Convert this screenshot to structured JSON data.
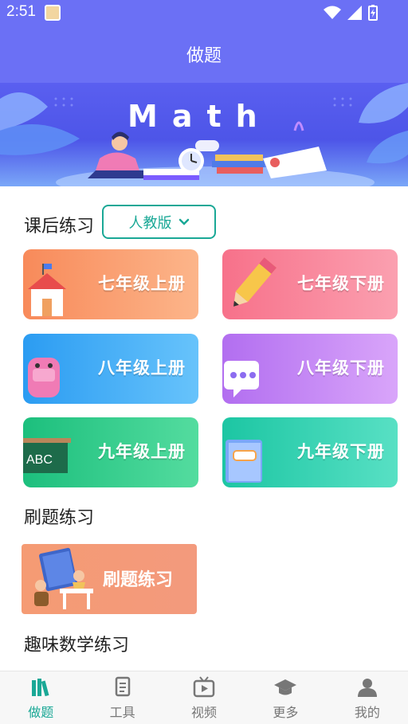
{
  "status_bar": {
    "time": "2:51"
  },
  "header": {
    "title": "做题"
  },
  "banner": {
    "word": "Math"
  },
  "homework": {
    "title": "课后练习",
    "edition": "人教版",
    "grades": [
      {
        "label": "七年级上册",
        "color_from": "#f88a5a",
        "color_to": "#fcb58a"
      },
      {
        "label": "七年级下册",
        "color_from": "#f7718a",
        "color_to": "#fba0b0"
      },
      {
        "label": "八年级上册",
        "color_from": "#2b9cf2",
        "color_to": "#67c3fb"
      },
      {
        "label": "八年级下册",
        "color_from": "#b26ef0",
        "color_to": "#d9a5fa"
      },
      {
        "label": "九年级上册",
        "color_from": "#1cbf7d",
        "color_to": "#54dc9f"
      },
      {
        "label": "九年级下册",
        "color_from": "#1cc6a3",
        "color_to": "#58e0c4"
      }
    ]
  },
  "drill": {
    "title": "刷题练习",
    "card_label": "刷题练习"
  },
  "fun": {
    "title": "趣味数学练习"
  },
  "nav": {
    "items": [
      {
        "label": "做题",
        "icon": "books-icon",
        "active": true
      },
      {
        "label": "工具",
        "icon": "document-icon",
        "active": false
      },
      {
        "label": "视频",
        "icon": "video-icon",
        "active": false
      },
      {
        "label": "更多",
        "icon": "graduation-cap-icon",
        "active": false
      },
      {
        "label": "我的",
        "icon": "user-icon",
        "active": false
      }
    ]
  },
  "colors": {
    "primary": "#6b70f5",
    "accent": "#1aa896"
  }
}
